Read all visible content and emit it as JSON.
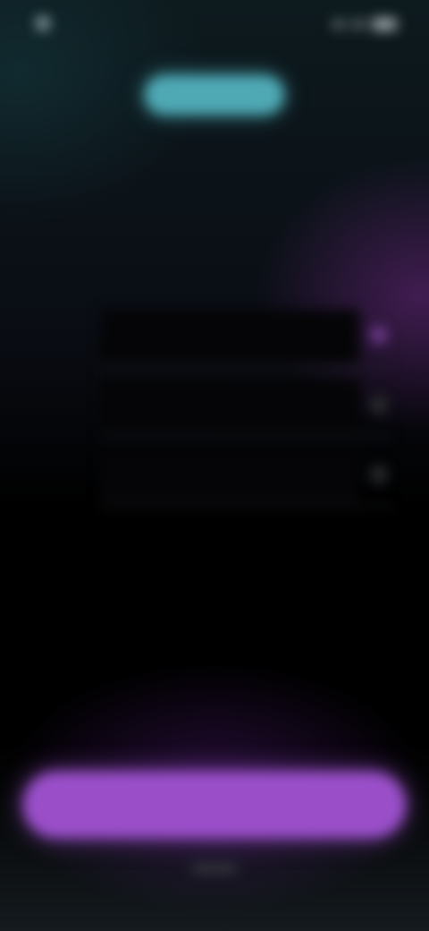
{
  "status_bar": {
    "time": "",
    "icons": [
      "notification-dot-icon",
      "signal-icon",
      "wifi-icon",
      "battery-icon"
    ]
  },
  "badge": {
    "label": ""
  },
  "heading": {
    "text": ""
  },
  "form": {
    "rows": [
      {
        "label": "",
        "value": "",
        "icon": "info-icon"
      },
      {
        "label": "",
        "value": "",
        "icon": "info-icon"
      },
      {
        "label": "",
        "value": "",
        "icon": "info-icon"
      }
    ]
  },
  "primary_button": {
    "label": ""
  },
  "colors": {
    "accent_teal": "#4fa9b5",
    "accent_purple": "#9a4fc9",
    "background": "#000000"
  }
}
